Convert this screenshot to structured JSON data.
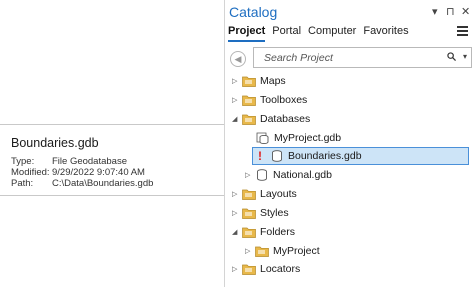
{
  "tooltip": {
    "title": "Boundaries.gdb",
    "rows": [
      {
        "key": "Type:",
        "value": "File Geodatabase"
      },
      {
        "key": "Modified:",
        "value": "9/29/2022 9:07:40 AM"
      },
      {
        "key": "Path:",
        "value": "C:\\Data\\Boundaries.gdb"
      }
    ]
  },
  "catalog": {
    "title": "Catalog",
    "window_buttons": {
      "dropdown": "▾",
      "pin": "⊓",
      "close": "✕"
    },
    "tabs": [
      "Project",
      "Portal",
      "Computer",
      "Favorites"
    ],
    "search": {
      "placeholder": "Search Project"
    },
    "tree": [
      {
        "label": "Maps",
        "icon": "maps-folder-icon",
        "level": 0,
        "caret": "collapsed"
      },
      {
        "label": "Toolboxes",
        "icon": "toolboxes-folder-icon",
        "level": 0,
        "caret": "collapsed"
      },
      {
        "label": "Databases",
        "icon": "databases-folder-icon",
        "level": 0,
        "caret": "expanded"
      },
      {
        "label": "MyProject.gdb",
        "icon": "default-geodatabase-icon",
        "level": 1,
        "caret": "none"
      },
      {
        "label": "Boundaries.gdb",
        "icon": "geodatabase-icon",
        "level": 1,
        "caret": "none",
        "selected": true,
        "warning": "!"
      },
      {
        "label": "National.gdb",
        "icon": "geodatabase-icon",
        "level": 1,
        "caret": "collapsed"
      },
      {
        "label": "Layouts",
        "icon": "layouts-folder-icon",
        "level": 0,
        "caret": "collapsed"
      },
      {
        "label": "Styles",
        "icon": "styles-folder-icon",
        "level": 0,
        "caret": "collapsed"
      },
      {
        "label": "Folders",
        "icon": "folders-icon",
        "level": 0,
        "caret": "expanded"
      },
      {
        "label": "MyProject",
        "icon": "folder-icon",
        "level": 1,
        "caret": "collapsed"
      },
      {
        "label": "Locators",
        "icon": "locators-folder-icon",
        "level": 0,
        "caret": "collapsed"
      }
    ]
  },
  "colors": {
    "accent": "#1e6ec1",
    "selection": "#cde4f7",
    "warning": "#e02020",
    "folder": "#e8b84a"
  }
}
